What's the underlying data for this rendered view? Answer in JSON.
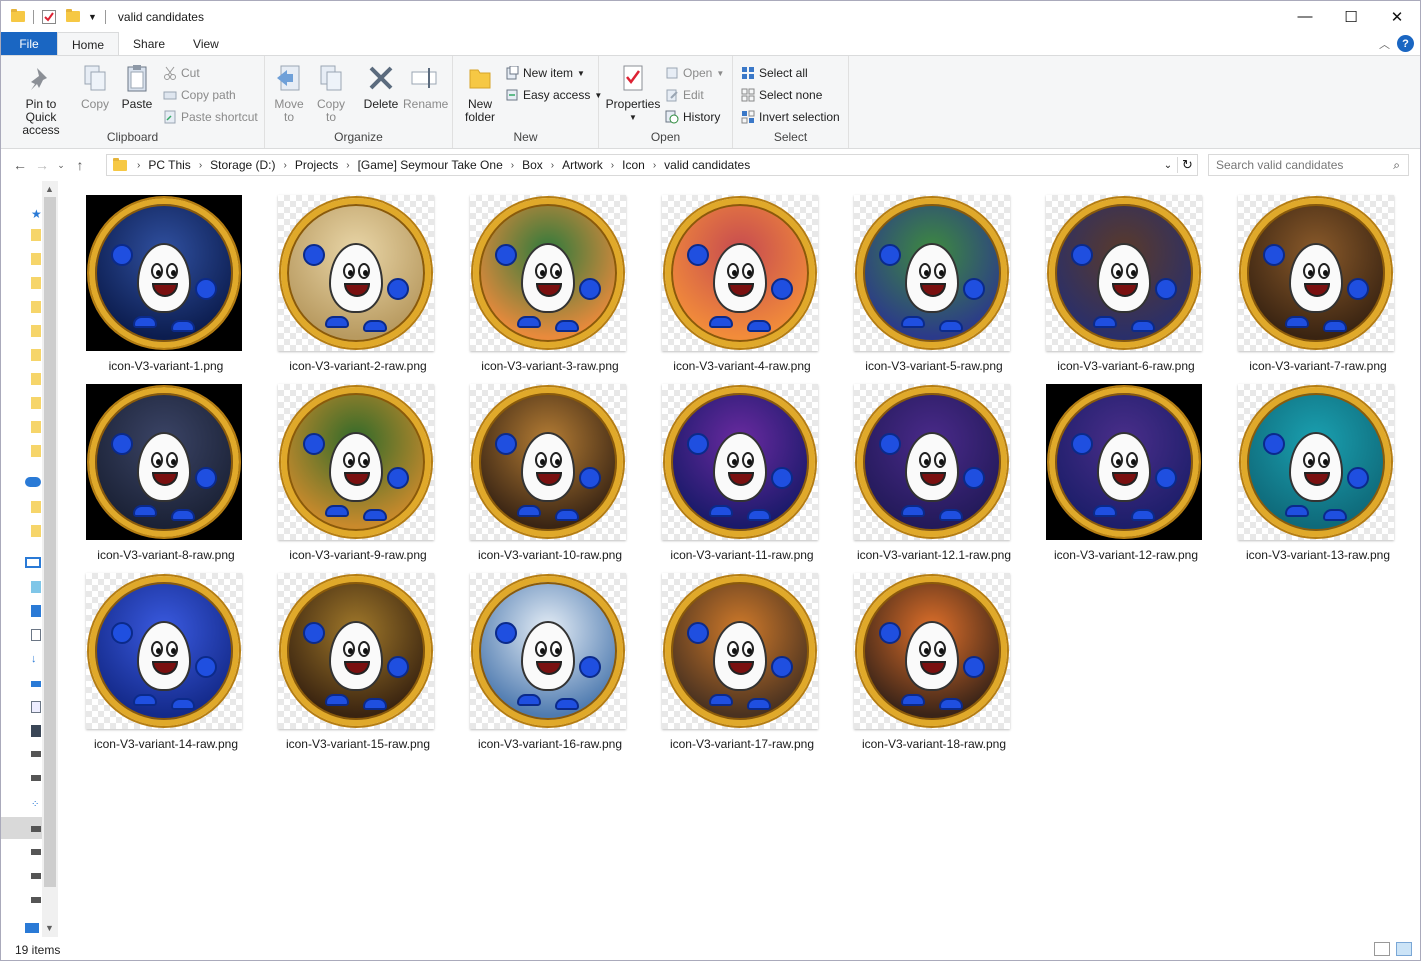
{
  "window": {
    "title": "valid candidates",
    "controls": {
      "minimize": "—",
      "maximize": "☐",
      "close": "✕"
    }
  },
  "ribbon_tabs": [
    {
      "label": "File"
    },
    {
      "label": "Home"
    },
    {
      "label": "Share"
    },
    {
      "label": "View"
    }
  ],
  "ribbon": {
    "clipboard": {
      "label": "Clipboard",
      "pin": "Pin to Quick access",
      "copy": "Copy",
      "paste": "Paste",
      "cut": "Cut",
      "copy_path": "Copy path",
      "paste_shortcut": "Paste shortcut"
    },
    "organize": {
      "label": "Organize",
      "move_to": "Move to",
      "copy_to": "Copy to",
      "delete": "Delete",
      "rename": "Rename"
    },
    "new": {
      "label": "New",
      "new_folder": "New folder",
      "new_item": "New item",
      "easy_access": "Easy access"
    },
    "open": {
      "label": "Open",
      "properties": "Properties",
      "open": "Open",
      "edit": "Edit",
      "history": "History"
    },
    "select": {
      "label": "Select",
      "select_all": "Select all",
      "select_none": "Select none",
      "invert_selection": "Invert selection"
    }
  },
  "address": {
    "breadcrumbs": [
      "PC This",
      "Storage (D:)",
      "Projects",
      "[Game] Seymour Take One",
      "Box",
      "Artwork",
      "Icon",
      "valid candidates"
    ],
    "search_placeholder": "Search valid candidates"
  },
  "files": [
    {
      "name": "icon-V3-variant-1.png",
      "bg": "black",
      "scene": "#0c1d4f",
      "scene2": "#3050a0"
    },
    {
      "name": "icon-V3-variant-2-raw.png",
      "bg": "checker",
      "scene": "#b89a60",
      "scene2": "#e9d6a8"
    },
    {
      "name": "icon-V3-variant-3-raw.png",
      "bg": "checker",
      "scene": "#e98a3c",
      "scene2": "#2d7a3c"
    },
    {
      "name": "icon-V3-variant-4-raw.png",
      "bg": "checker",
      "scene": "#f28c3a",
      "scene2": "#c64a50"
    },
    {
      "name": "icon-V3-variant-5-raw.png",
      "bg": "checker",
      "scene": "#2b3a8a",
      "scene2": "#3e8b3e"
    },
    {
      "name": "icon-V3-variant-6-raw.png",
      "bg": "checker",
      "scene": "#2a2f6a",
      "scene2": "#5a3a2a"
    },
    {
      "name": "icon-V3-variant-7-raw.png",
      "bg": "checker",
      "scene": "#3a2412",
      "scene2": "#8a5a2a"
    },
    {
      "name": "icon-V3-variant-8-raw.png",
      "bg": "black",
      "scene": "#1b2236",
      "scene2": "#3b4466"
    },
    {
      "name": "icon-V3-variant-9-raw.png",
      "bg": "checker",
      "scene": "#c98a2c",
      "scene2": "#2f6a2a"
    },
    {
      "name": "icon-V3-variant-10-raw.png",
      "bg": "checker",
      "scene": "#3a2514",
      "scene2": "#b57d34"
    },
    {
      "name": "icon-V3-variant-11-raw.png",
      "bg": "checker",
      "scene": "#1a1a6a",
      "scene2": "#6a2aa0"
    },
    {
      "name": "icon-V3-variant-12.1-raw.png",
      "bg": "checker",
      "scene": "#231a5a",
      "scene2": "#4a2a8a"
    },
    {
      "name": "icon-V3-variant-12-raw.png",
      "bg": "black",
      "scene": "#1d1e6a",
      "scene2": "#4a2e8a"
    },
    {
      "name": "icon-V3-variant-13-raw.png",
      "bg": "checker",
      "scene": "#0f6a7a",
      "scene2": "#1aa0b0"
    },
    {
      "name": "icon-V3-variant-14-raw.png",
      "bg": "checker",
      "scene": "#142a8a",
      "scene2": "#3a5ae0"
    },
    {
      "name": "icon-V3-variant-15-raw.png",
      "bg": "checker",
      "scene": "#3a2410",
      "scene2": "#a0782a"
    },
    {
      "name": "icon-V3-variant-16-raw.png",
      "bg": "checker",
      "scene": "#4f7bb0",
      "scene2": "#e6eef6"
    },
    {
      "name": "icon-V3-variant-17-raw.png",
      "bg": "checker",
      "scene": "#4a3220",
      "scene2": "#d07a2a"
    },
    {
      "name": "icon-V3-variant-18-raw.png",
      "bg": "checker",
      "scene": "#3a2418",
      "scene2": "#e0702a"
    }
  ],
  "status": {
    "item_count": "19 items"
  }
}
